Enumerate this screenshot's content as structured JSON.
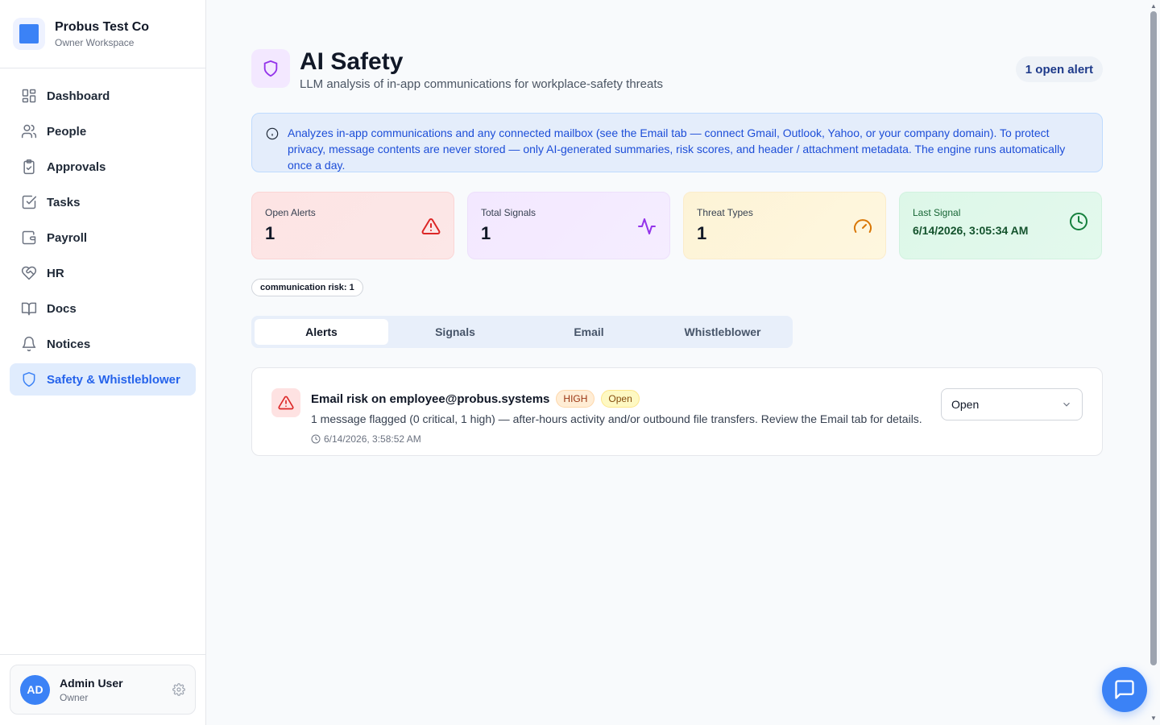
{
  "brand": {
    "name": "Probus Test Co",
    "subtitle": "Owner Workspace"
  },
  "nav": {
    "items": [
      {
        "label": "Dashboard",
        "icon": "grid-icon"
      },
      {
        "label": "People",
        "icon": "users-icon"
      },
      {
        "label": "Approvals",
        "icon": "clipboard-check-icon"
      },
      {
        "label": "Tasks",
        "icon": "checkbox-icon"
      },
      {
        "label": "Payroll",
        "icon": "wallet-icon"
      },
      {
        "label": "HR",
        "icon": "heart-handshake-icon"
      },
      {
        "label": "Docs",
        "icon": "book-icon"
      },
      {
        "label": "Notices",
        "icon": "bell-icon"
      },
      {
        "label": "Safety & Whistleblower",
        "icon": "shield-icon",
        "active": true
      }
    ]
  },
  "user": {
    "initials": "AD",
    "name": "Admin User",
    "role": "Owner"
  },
  "header": {
    "title": "AI Safety",
    "subtitle": "LLM analysis of in-app communications for workplace-safety threats",
    "open_alerts_pill": "1 open alert"
  },
  "info": {
    "text": "Analyzes in-app communications and any connected mailbox (see the Email tab — connect Gmail, Outlook, Yahoo, or your company domain). To protect privacy, message contents are never stored — only AI-generated summaries, risk scores, and header / attachment metadata. The engine runs automatically once a day."
  },
  "stats": {
    "open_alerts": {
      "label": "Open Alerts",
      "value": "1"
    },
    "total_signals": {
      "label": "Total Signals",
      "value": "1"
    },
    "threat_types": {
      "label": "Threat Types",
      "value": "1"
    },
    "last_signal": {
      "label": "Last Signal",
      "value": "6/14/2026, 3:05:34 AM"
    }
  },
  "filter_chip": "communication risk: 1",
  "tabs": [
    {
      "label": "Alerts",
      "active": true
    },
    {
      "label": "Signals"
    },
    {
      "label": "Email"
    },
    {
      "label": "Whistleblower"
    }
  ],
  "alert": {
    "title": "Email risk on employee@probus.systems",
    "severity": "HIGH",
    "status_badge": "Open",
    "description": "1 message flagged (0 critical, 1 high) — after-hours activity and/or outbound file transfers. Review the Email tab for details.",
    "timestamp": "6/14/2026, 3:58:52 AM",
    "status_select": "Open"
  },
  "colors": {
    "accent": "#3b82f6",
    "danger": "#dc2626",
    "purple": "#9333ea",
    "amber": "#d97706",
    "green": "#15803d"
  }
}
